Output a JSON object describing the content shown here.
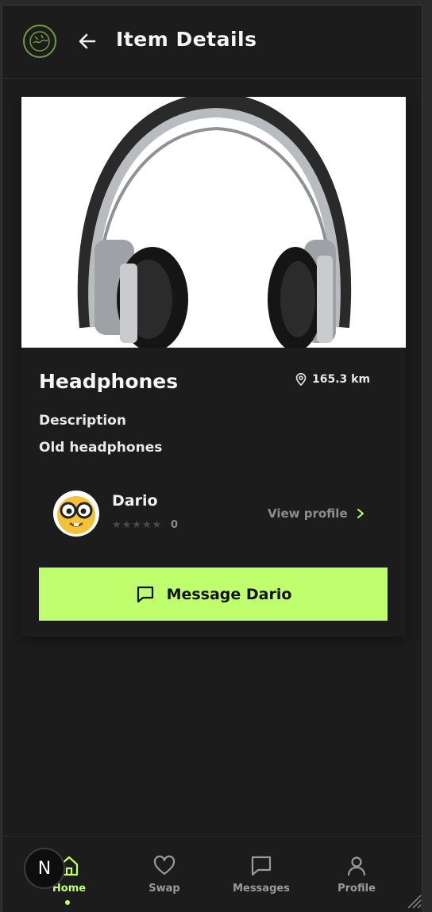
{
  "header": {
    "title": "Item Details"
  },
  "item": {
    "name": "Headphones",
    "distance": "165.3 km",
    "description_label": "Description",
    "description": "Old headphones"
  },
  "owner": {
    "name": "Dario",
    "rating": 0,
    "rating_count": "0",
    "view_profile_label": "View profile"
  },
  "actions": {
    "message_label": "Message Dario"
  },
  "nav": {
    "items": [
      {
        "label": "Home",
        "icon": "home-icon",
        "active": true
      },
      {
        "label": "Swap",
        "icon": "heart-icon",
        "active": false
      },
      {
        "label": "Messages",
        "icon": "chat-icon",
        "active": false
      },
      {
        "label": "Profile",
        "icon": "user-icon",
        "active": false
      }
    ]
  },
  "badge": {
    "letter": "N"
  },
  "colors": {
    "accent": "#bfff6e",
    "background": "#1c1c1c",
    "logo": "#6f9c3b"
  }
}
